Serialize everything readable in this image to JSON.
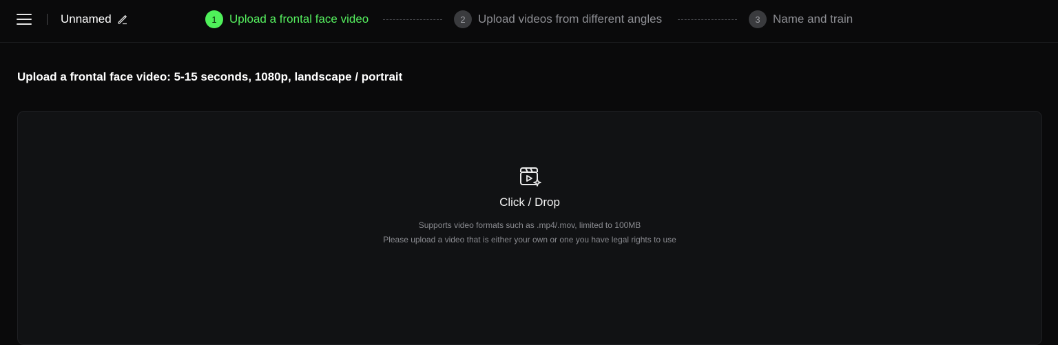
{
  "header": {
    "project_name": "Unnamed",
    "steps": [
      {
        "number": "1",
        "label": "Upload a frontal face video",
        "state": "active"
      },
      {
        "number": "2",
        "label": "Upload videos from different angles",
        "state": "inactive"
      },
      {
        "number": "3",
        "label": "Name and train",
        "state": "inactive"
      }
    ]
  },
  "main": {
    "heading": "Upload a frontal face video: 5-15 seconds, 1080p, landscape / portrait",
    "dropzone": {
      "icon": "video-clapper-sparkle-icon",
      "cta": "Click / Drop",
      "hint_formats": "Supports video formats such as .mp4/.mov, limited to 100MB",
      "hint_rights": "Please upload a video that is either your own or one you have legal rights to use"
    }
  },
  "colors": {
    "accent": "#56f05f",
    "background": "#0a0a0b",
    "panel": "#111214"
  }
}
